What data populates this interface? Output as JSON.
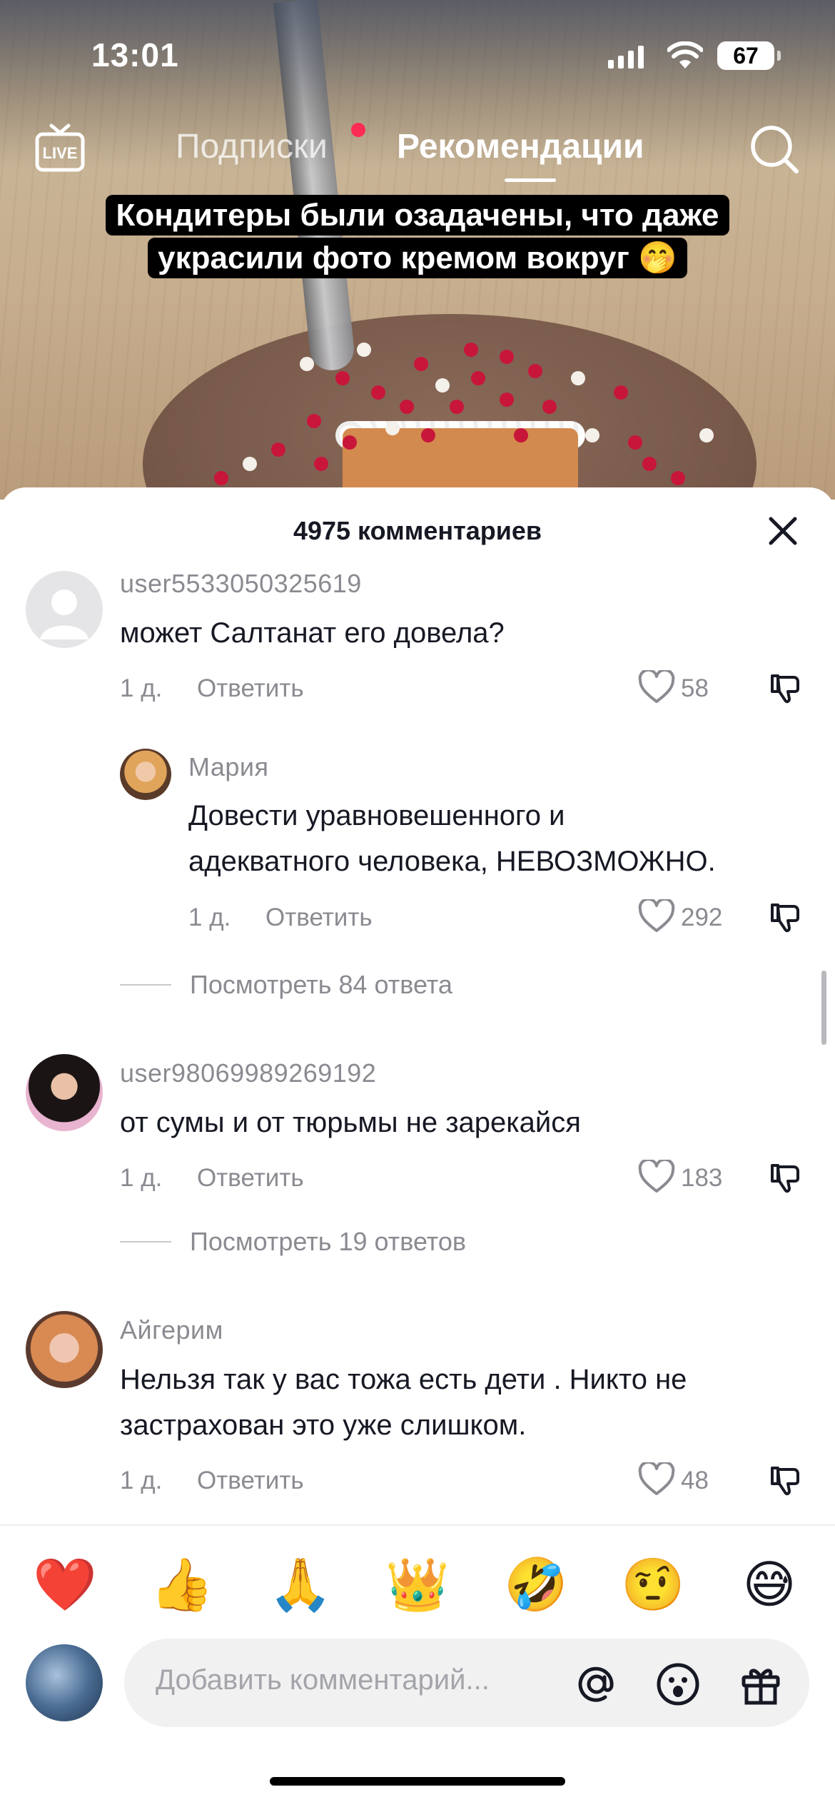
{
  "status_bar": {
    "time": "13:01",
    "battery": "67"
  },
  "top_nav": {
    "live_label": "LIVE",
    "tabs": [
      {
        "label": "Подписки",
        "active": false,
        "has_dot": true
      },
      {
        "label": "Рекомендации",
        "active": true
      }
    ]
  },
  "video": {
    "caption_line1": "Кондитеры были озадачены, что даже",
    "caption_line2": "украсили фото кремом вокруг 🤭"
  },
  "comments_sheet": {
    "title": "4975 комментариев",
    "comments": [
      {
        "username": "user5533050325619",
        "text": "может Салтанат его довела?",
        "date": "1 д.",
        "reply_label": "Ответить",
        "likes": "58",
        "replies": [
          {
            "username": "Мария",
            "text_line1": "Довести уравновешенного и",
            "text_line2": "адекватного человека, НЕВОЗМОЖНО.",
            "date": "1 д.",
            "reply_label": "Ответить",
            "likes": "292"
          }
        ],
        "view_replies": "Посмотреть 84 ответа"
      },
      {
        "username": "user98069989269192",
        "text": "от сумы и от тюрьмы не зарекайся",
        "date": "1 д.",
        "reply_label": "Ответить",
        "likes": "183",
        "view_replies": "Посмотреть 19 ответов"
      },
      {
        "username": "Айгерим",
        "text_line1": "Нельзя так у вас тожа есть дети . Никто не",
        "text_line2": "застрахован это уже слишком.",
        "date": "1 д.",
        "reply_label": "Ответить",
        "likes": "48"
      }
    ]
  },
  "emoji_bar": [
    "❤️",
    "👍",
    "🙏",
    "👑",
    "🤣",
    "🤨",
    "😅"
  ],
  "input": {
    "placeholder": "Добавить комментарий...",
    "icons": [
      "mention-icon",
      "emoji-icon",
      "gift-icon"
    ]
  },
  "colors": {
    "accent": "#fe2c55",
    "text": "#161823",
    "secondary_text": "#8a8b91"
  }
}
